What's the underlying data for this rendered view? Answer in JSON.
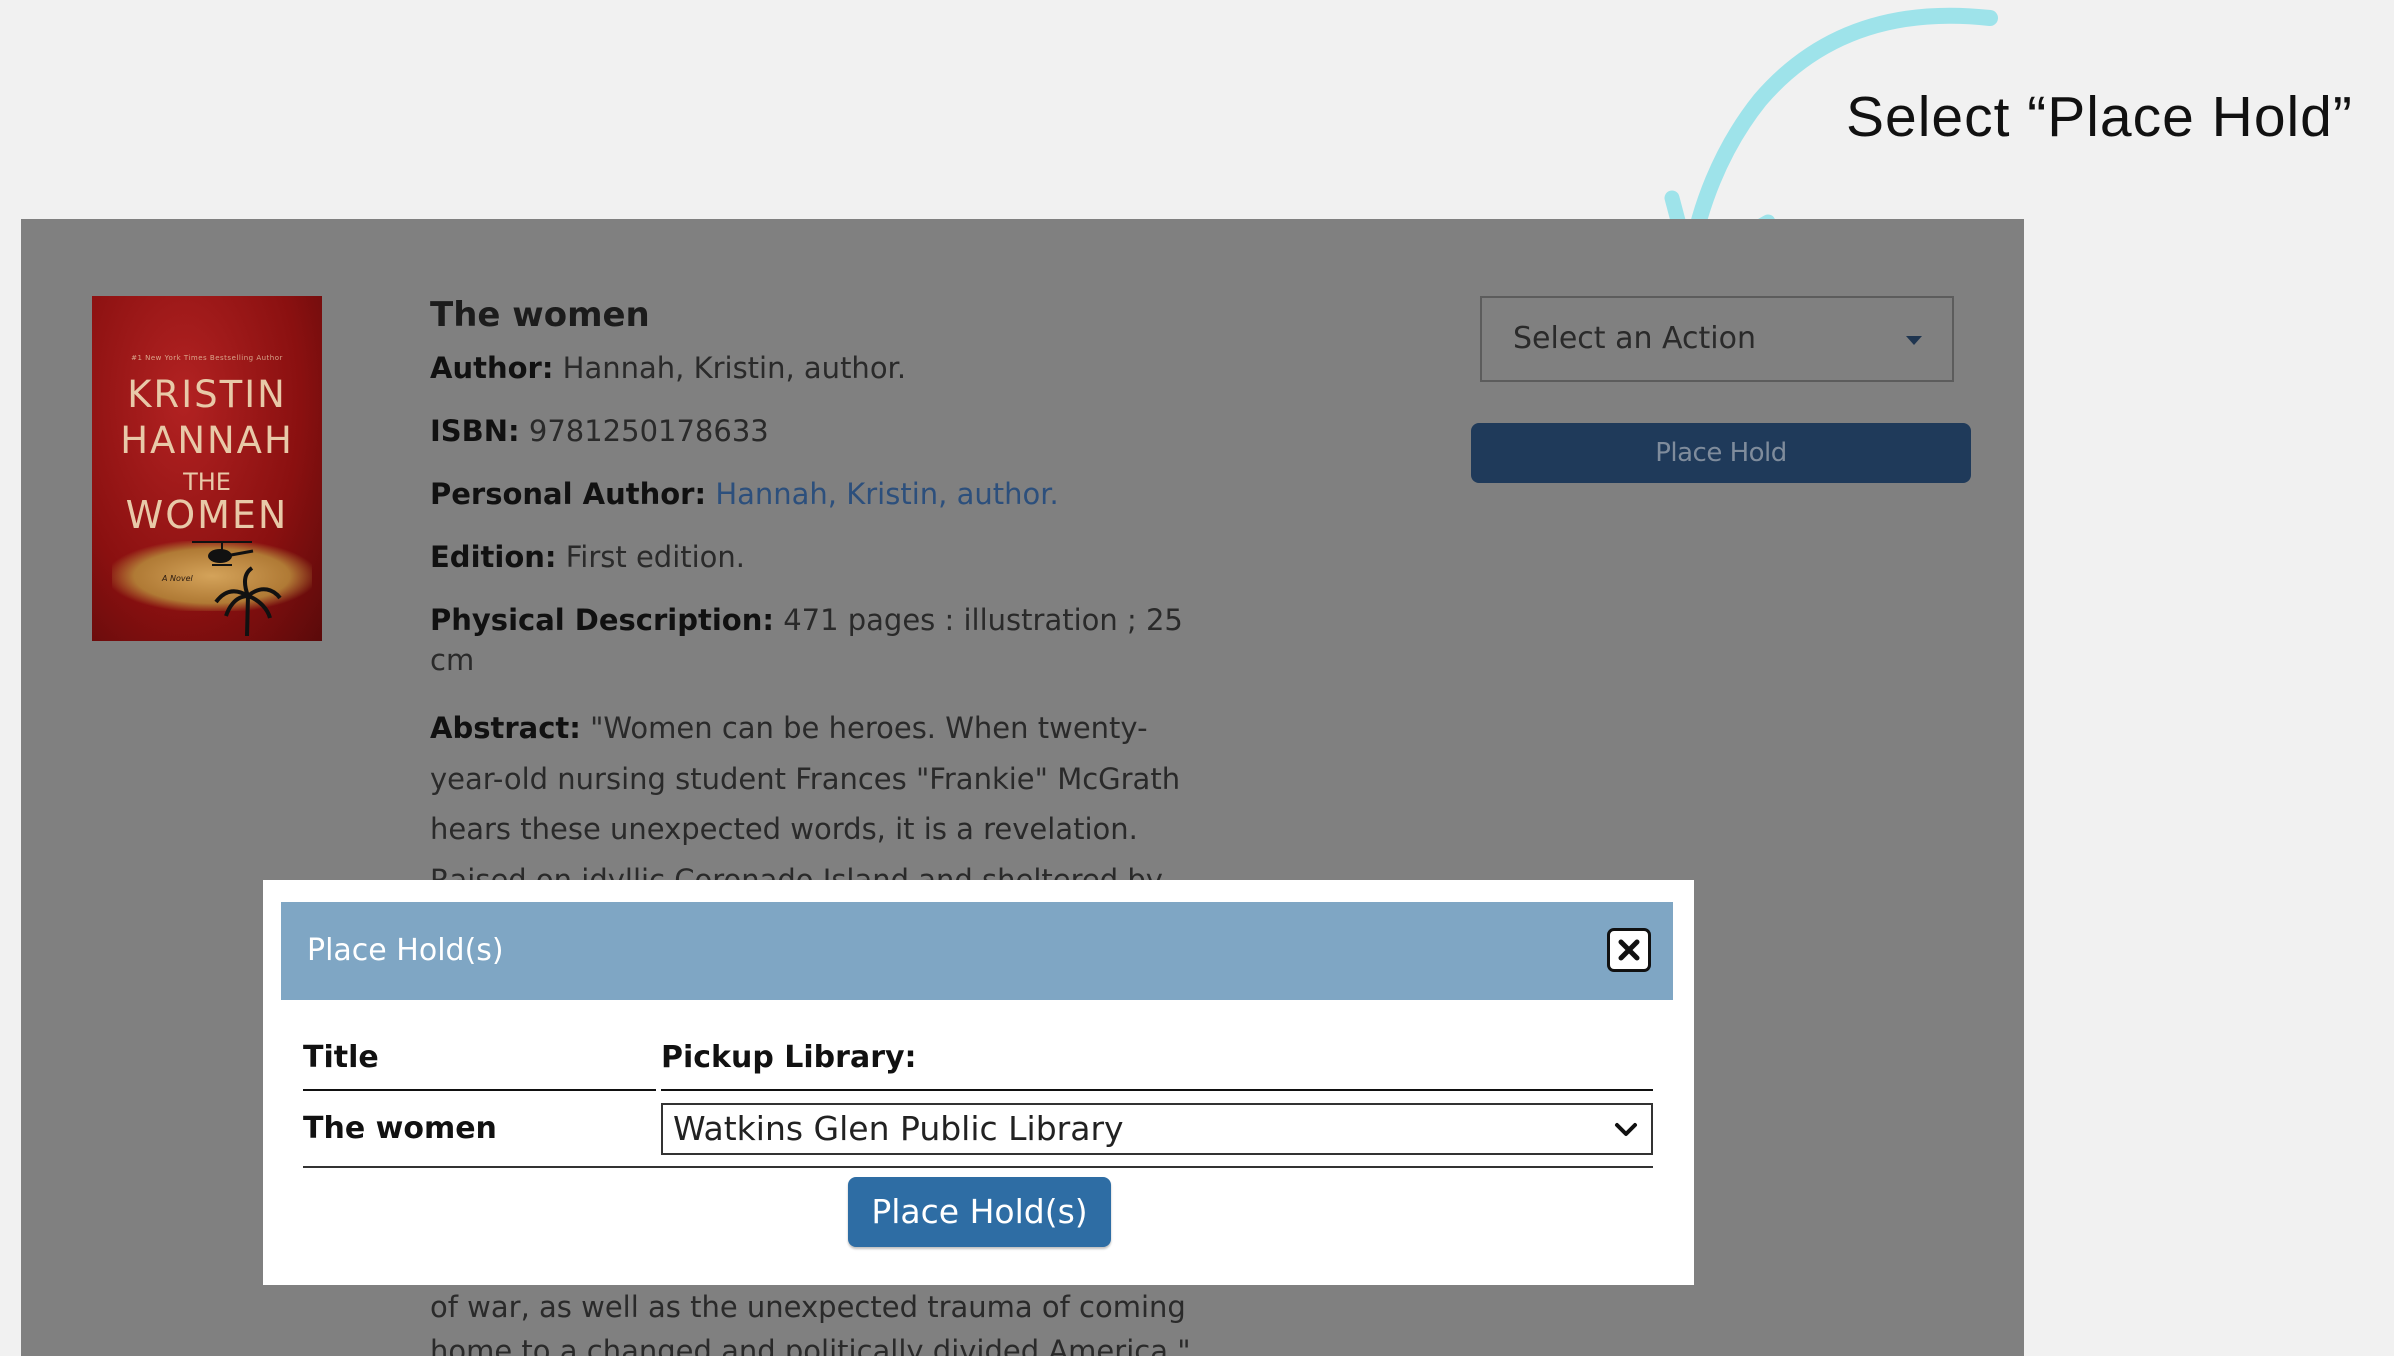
{
  "annotation": {
    "text": "Select “Place Hold”",
    "arrow_color": "#9ee3ea"
  },
  "book": {
    "cover": {
      "kicker": "#1 New York Times Bestselling Author",
      "author": [
        "KRISTIN",
        "HANNAH"
      ],
      "the": "THE",
      "title": "WOMEN",
      "subtitle": "A Novel"
    },
    "title": "The women",
    "fields": {
      "author_label": "Author:",
      "author_value": "Hannah, Kristin, author.",
      "isbn_label": "ISBN:",
      "isbn_value": "9781250178633",
      "personal_author_label": "Personal Author:",
      "personal_author_value": "Hannah, Kristin, author.",
      "edition_label": "Edition:",
      "edition_value": "First edition.",
      "physical_label": "Physical Description:",
      "physical_value": "471 pages : illustration ; 25 cm",
      "abstract_label": "Abstract:",
      "abstract_value": "\"Women can be heroes. When twenty-year-old nursing student Frances \"Frankie\" McGrath hears these unexpected words, it is a revelation. Raised on idyllic Coronado Island and sheltered by her",
      "abstract_tail": "of war, as well as the unexpected trauma of coming home to a changed and politically divided America.\""
    }
  },
  "actions": {
    "select_placeholder": "Select an Action",
    "place_hold": "Place Hold"
  },
  "modal": {
    "title": "Place Hold(s)",
    "col_title": "Title",
    "col_pickup": "Pickup Library:",
    "row_title": "The women",
    "pickup_value": "Watkins Glen Public Library",
    "submit": "Place Hold(s)"
  },
  "colors": {
    "overlay": "#808080",
    "modal_header": "#7fa6c4",
    "submit_button": "#2e6da4",
    "top_button": "#1f3a5a"
  }
}
